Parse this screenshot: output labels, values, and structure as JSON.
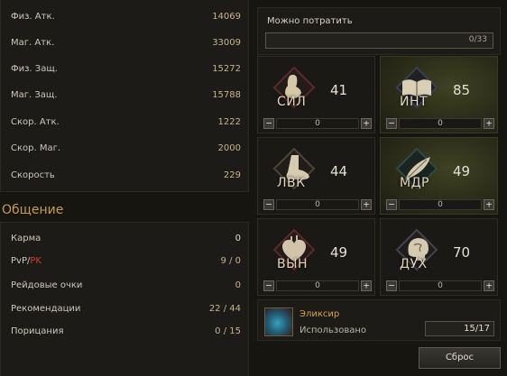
{
  "combat_stats": [
    {
      "label": "Физ. Атк.",
      "value": "14069"
    },
    {
      "label": "Маг. Атк.",
      "value": "33009"
    },
    {
      "label": "Физ. Защ.",
      "value": "15272"
    },
    {
      "label": "Маг. Защ.",
      "value": "15788"
    },
    {
      "label": "Скор. Атк.",
      "value": "1222"
    },
    {
      "label": "Скор. Маг.",
      "value": "2000"
    },
    {
      "label": "Скорость",
      "value": "229"
    }
  ],
  "communication": {
    "title": "Общение",
    "karma": {
      "label": "Карма",
      "value": "0"
    },
    "pvp": {
      "label_pvp": "PvP/",
      "label_pk": "PK",
      "value": "9 / 0"
    },
    "raid_points": {
      "label": "Рейдовые очки",
      "value": "0"
    },
    "recommendations": {
      "label": "Рекомендации",
      "value": "22 / 44"
    },
    "blames": {
      "label": "Порицания",
      "value": "0 / 15"
    }
  },
  "spend": {
    "label": "Можно потратить",
    "value": "0/33"
  },
  "attributes": [
    {
      "abbr": "СИЛ",
      "value": "41",
      "input": "0",
      "icon": "fist-icon",
      "highlight": false
    },
    {
      "abbr": "ИНТ",
      "value": "85",
      "input": "0",
      "icon": "book-icon",
      "highlight": true
    },
    {
      "abbr": "ЛВК",
      "value": "44",
      "input": "0",
      "icon": "foot-icon",
      "highlight": false
    },
    {
      "abbr": "МДР",
      "value": "49",
      "input": "0",
      "icon": "feather-icon",
      "highlight": true
    },
    {
      "abbr": "ВЫН",
      "value": "49",
      "input": "0",
      "icon": "heart-icon",
      "highlight": false
    },
    {
      "abbr": "ДУХ",
      "value": "70",
      "input": "0",
      "icon": "mind-icon",
      "highlight": false
    }
  ],
  "controls": {
    "minus": "−",
    "plus": "+"
  },
  "elixir": {
    "name": "Эликсир",
    "used_label": "Использовано",
    "count": "15/17"
  },
  "reset_label": "Сброс",
  "colors": {
    "accent_gold": "#c79b52",
    "pk_red": "#d23b2c",
    "highlight_olive": "#3f4223"
  }
}
